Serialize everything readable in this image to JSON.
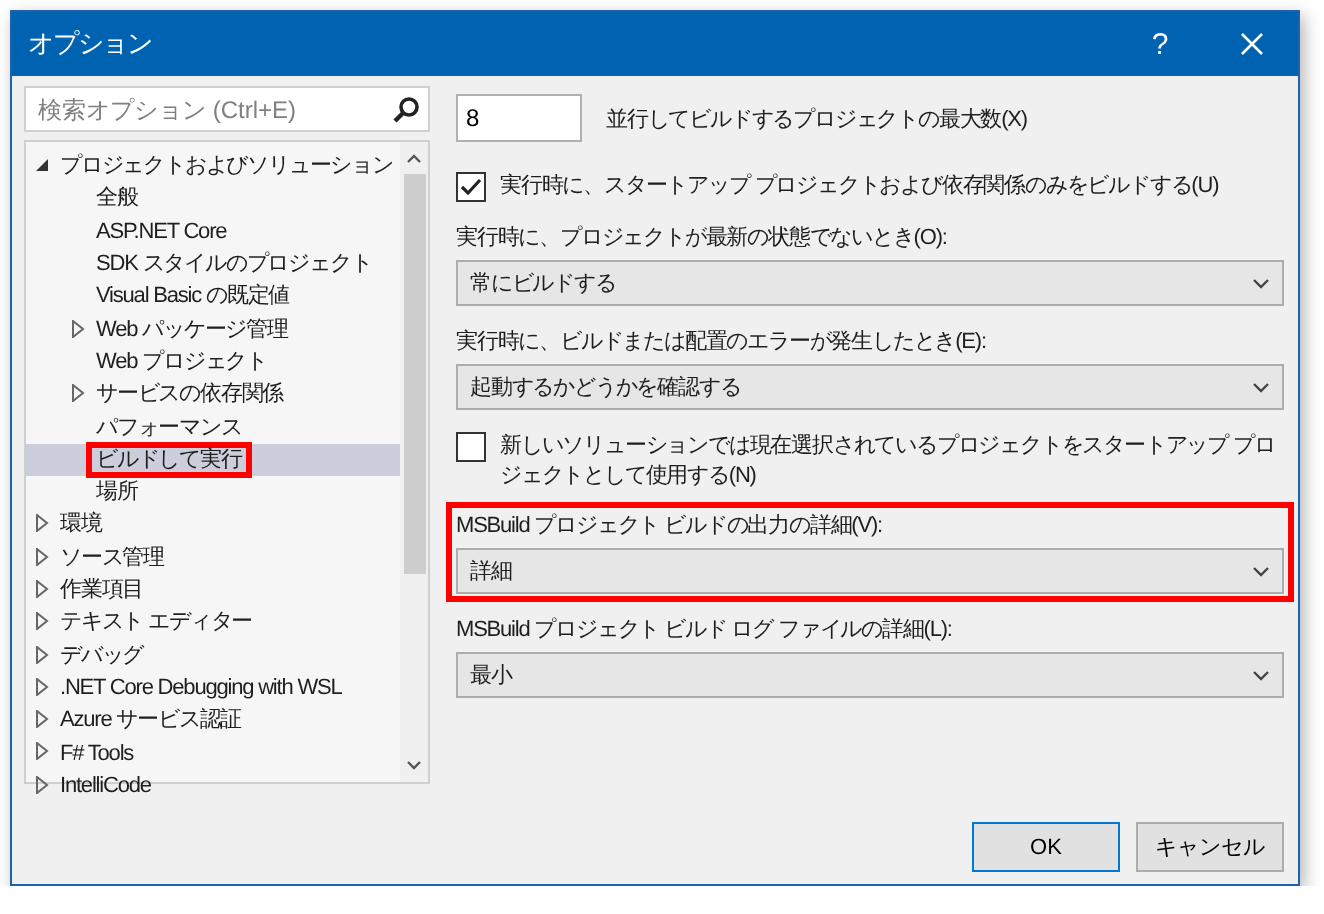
{
  "window": {
    "title": "オプション",
    "help": "?"
  },
  "search": {
    "placeholder": "検索オプション (Ctrl+E)"
  },
  "tree": [
    {
      "label": "プロジェクトおよびソリューション",
      "kind": "group",
      "expanded": true,
      "selected": false,
      "highlighted": false,
      "children": [
        {
          "label": "全般",
          "kind": "page",
          "selected": false,
          "highlighted": false
        },
        {
          "label": "ASP.NET Core",
          "kind": "page",
          "selected": false,
          "highlighted": false
        },
        {
          "label": "SDK スタイルのプロジェクト",
          "kind": "page",
          "selected": false,
          "highlighted": false
        },
        {
          "label": "Visual Basic の既定値",
          "kind": "page",
          "selected": false,
          "highlighted": false
        },
        {
          "label": "Web パッケージ管理",
          "kind": "group",
          "expanded": false,
          "selected": false,
          "highlighted": false
        },
        {
          "label": "Web プロジェクト",
          "kind": "page",
          "selected": false,
          "highlighted": false
        },
        {
          "label": "サービスの依存関係",
          "kind": "group",
          "expanded": false,
          "selected": false,
          "highlighted": false
        },
        {
          "label": "パフォーマンス",
          "kind": "page",
          "selected": false,
          "highlighted": false
        },
        {
          "label": "ビルドして実行",
          "kind": "page",
          "selected": true,
          "highlighted": true
        },
        {
          "label": "場所",
          "kind": "page",
          "selected": false,
          "highlighted": false
        }
      ]
    },
    {
      "label": "環境",
      "kind": "group",
      "expanded": false,
      "selected": false,
      "highlighted": false
    },
    {
      "label": "ソース管理",
      "kind": "group",
      "expanded": false,
      "selected": false,
      "highlighted": false
    },
    {
      "label": "作業項目",
      "kind": "group",
      "expanded": false,
      "selected": false,
      "highlighted": false
    },
    {
      "label": "テキスト エディター",
      "kind": "group",
      "expanded": false,
      "selected": false,
      "highlighted": false
    },
    {
      "label": "デバッグ",
      "kind": "group",
      "expanded": false,
      "selected": false,
      "highlighted": false
    },
    {
      "label": ".NET Core Debugging with WSL",
      "kind": "group",
      "expanded": false,
      "selected": false,
      "highlighted": false
    },
    {
      "label": "Azure サービス認証",
      "kind": "group",
      "expanded": false,
      "selected": false,
      "highlighted": false
    },
    {
      "label": "F# Tools",
      "kind": "group",
      "expanded": false,
      "selected": false,
      "highlighted": false
    },
    {
      "label": "IntelliCode",
      "kind": "group",
      "expanded": false,
      "selected": false,
      "highlighted": false
    }
  ],
  "settings": [
    {
      "kind": "number",
      "value": "8",
      "label": "並行してビルドするプロジェクトの最大数(X)",
      "highlighted": false
    },
    {
      "kind": "checkbox",
      "checked": true,
      "label": "実行時に、スタートアップ プロジェクトおよび依存関係のみをビルドする(U)",
      "highlighted": false
    },
    {
      "kind": "select",
      "label": "実行時に、プロジェクトが最新の状態でないとき(O):",
      "value": "常にビルドする",
      "highlighted": false
    },
    {
      "kind": "select",
      "label": "実行時に、ビルドまたは配置のエラーが発生したとき(E):",
      "value": "起動するかどうかを確認する",
      "highlighted": false
    },
    {
      "kind": "checkbox",
      "checked": false,
      "label": "新しいソリューションでは現在選択されているプロジェクトをスタートアップ プロジェクトとして使用する(N)",
      "highlighted": false
    },
    {
      "kind": "select",
      "label": "MSBuild プロジェクト ビルドの出力の詳細(V):",
      "value": "詳細",
      "highlighted": true
    },
    {
      "kind": "select",
      "label": "MSBuild プロジェクト ビルド ログ ファイルの詳細(L):",
      "value": "最小",
      "highlighted": false
    }
  ],
  "buttons": [
    {
      "label": "OK",
      "default": true
    },
    {
      "label": "キャンセル",
      "default": false
    }
  ]
}
